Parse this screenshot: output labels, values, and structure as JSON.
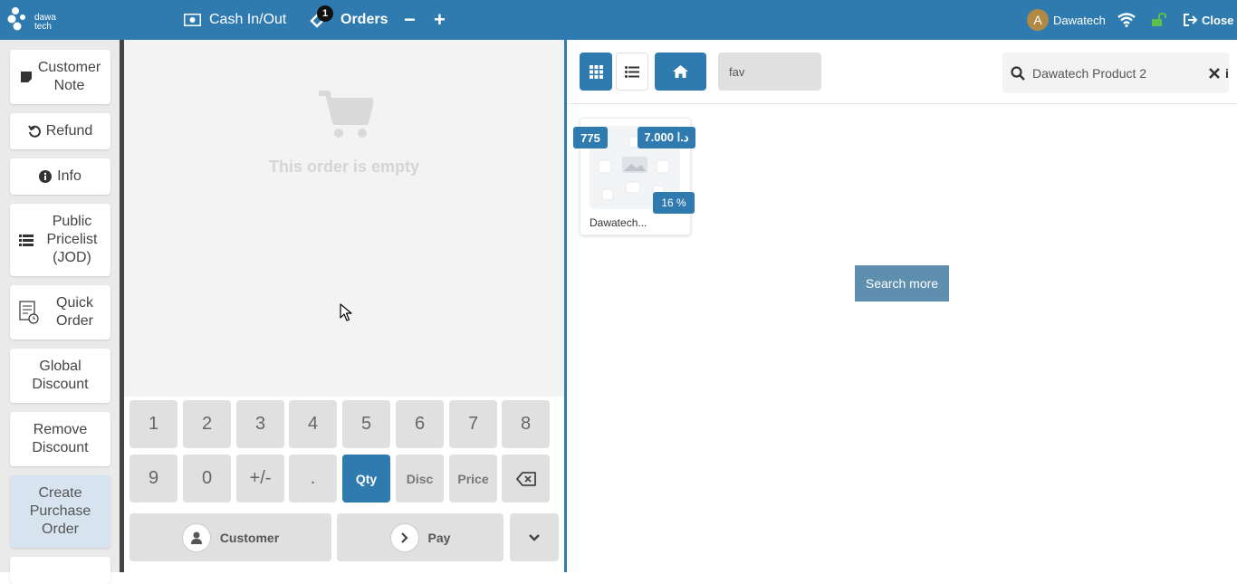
{
  "topbar": {
    "logo_text_line1": "dawa",
    "logo_text_line2": "tech",
    "cash_label": "Cash In/Out",
    "orders_label": "Orders",
    "orders_count": "1",
    "minus_label": "−",
    "plus_label": "+",
    "user_initial": "A",
    "user_name": "Dawatech",
    "close_label": "Close",
    "brand_color": "#2f7bb0"
  },
  "controls": [
    {
      "label": "Customer Note",
      "icon": "note-icon"
    },
    {
      "label": "Refund",
      "icon": "undo-icon"
    },
    {
      "label": "Info",
      "icon": "info-icon"
    },
    {
      "label": "Public Pricelist (JOD)",
      "icon": "list-icon"
    },
    {
      "label": "Quick Order",
      "icon": "quick-order-icon"
    },
    {
      "label": "Global Discount"
    },
    {
      "label": "Remove Discount"
    },
    {
      "label": "Create Purchase Order"
    }
  ],
  "order": {
    "empty_text": "This order is empty"
  },
  "numpad": {
    "keys_row1": [
      "1",
      "2",
      "3",
      "4",
      "5",
      "6",
      "7",
      "8"
    ],
    "keys_row2": [
      "9",
      "0",
      "+/-",
      "."
    ],
    "qty": "Qty",
    "disc": "Disc",
    "price": "Price",
    "customer": "Customer",
    "pay": "Pay"
  },
  "products_header": {
    "category": "fav",
    "search_value": "Dawatech Product 2"
  },
  "products": [
    {
      "name": "Dawatech...",
      "qty": "775",
      "price": "7.000 د.ا",
      "tax": "16 %"
    }
  ],
  "search_more_label": "Search more"
}
